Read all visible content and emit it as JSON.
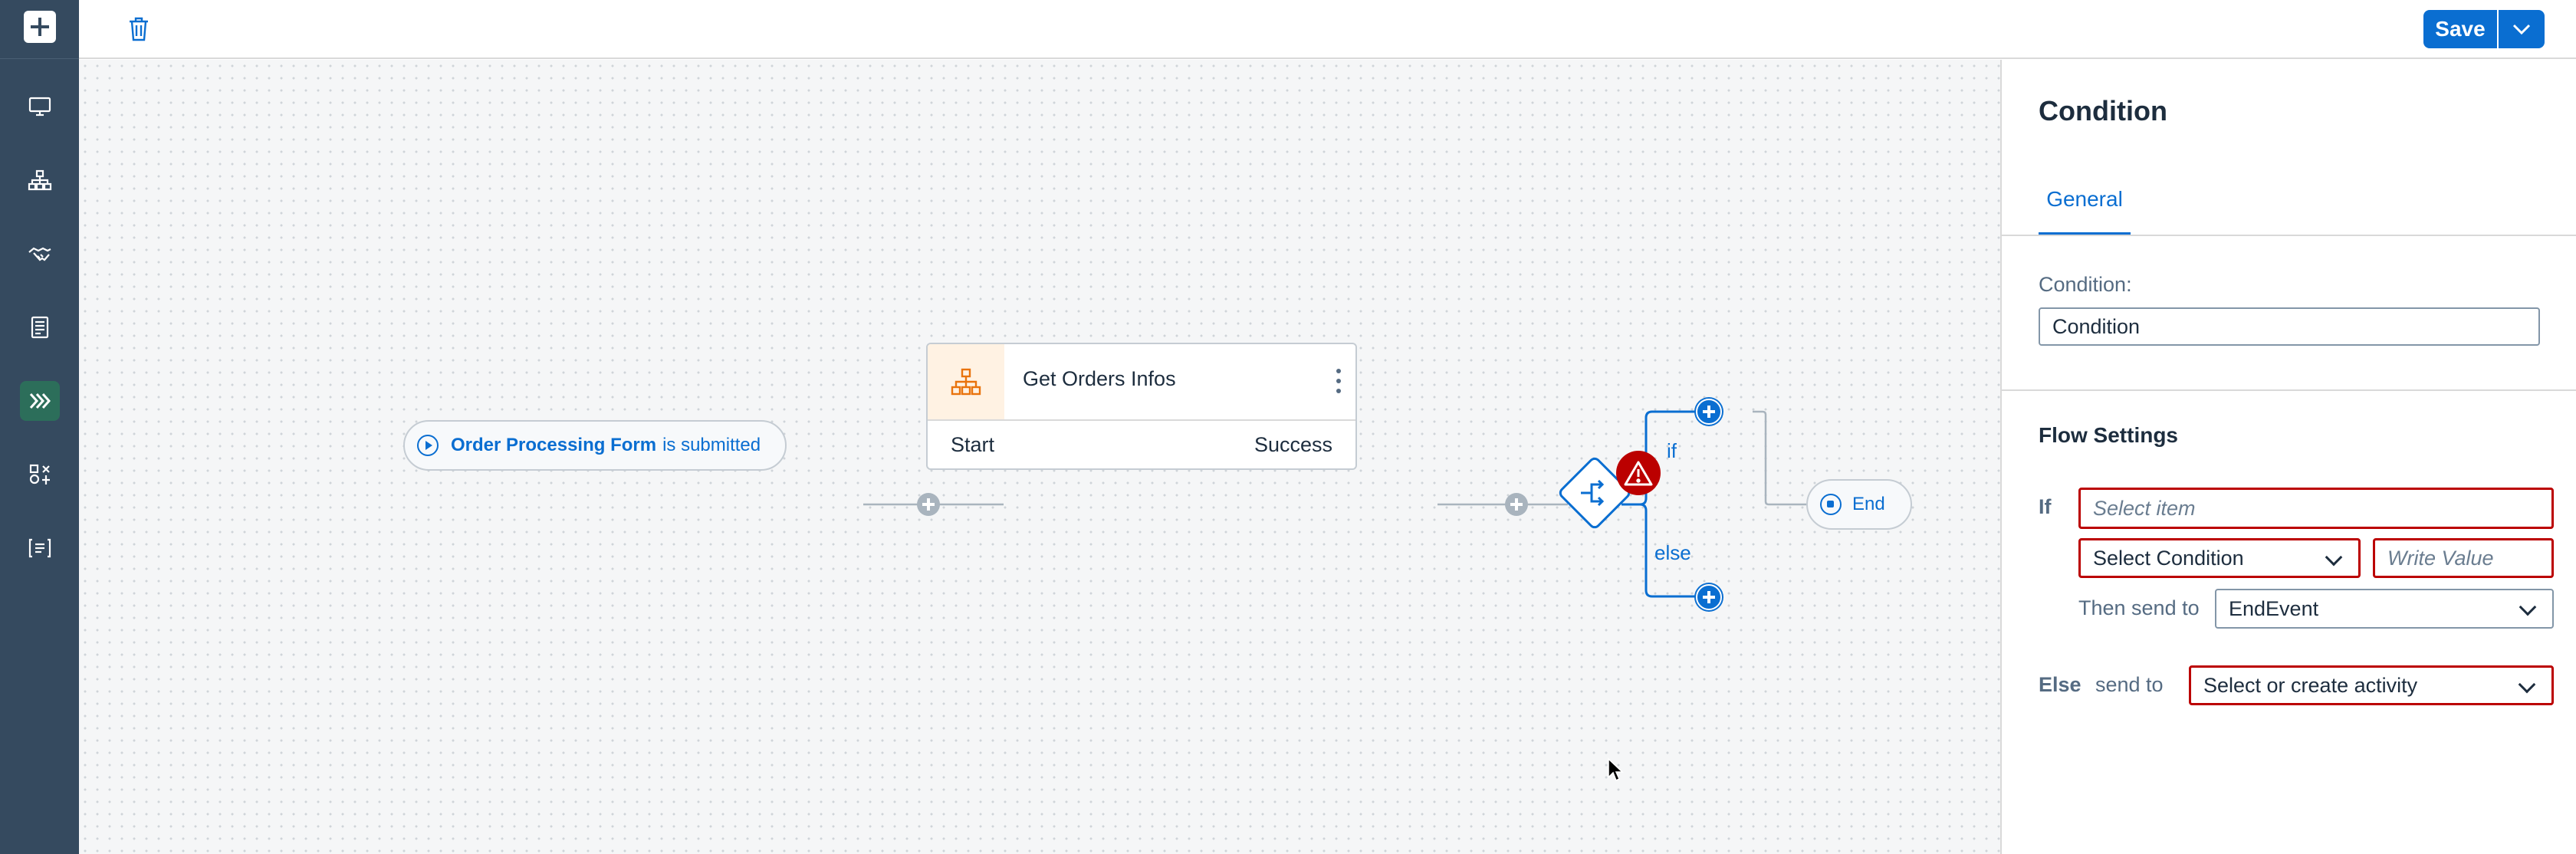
{
  "rail": {
    "items": [
      {
        "icon": "add-icon"
      },
      {
        "icon": "monitor-icon"
      },
      {
        "icon": "hierarchy-icon"
      },
      {
        "icon": "handshake-icon"
      },
      {
        "icon": "document-icon"
      },
      {
        "icon": "process-icon",
        "active": true
      },
      {
        "icon": "settings-icon"
      },
      {
        "icon": "form-icon"
      }
    ]
  },
  "toolbar": {
    "delete_icon": "trash-icon",
    "save_label": "Save",
    "save_menu_icon": "chevron-down-icon"
  },
  "canvas": {
    "trigger": {
      "name": "Order Processing Form",
      "suffix": "is submitted"
    },
    "activity": {
      "title": "Get Orders Infos",
      "start_label": "Start",
      "success_label": "Success"
    },
    "condition": {
      "if_label": "if",
      "else_label": "else"
    },
    "end_label": "End"
  },
  "panel": {
    "title": "Condition",
    "tabs": [
      {
        "label": "General",
        "selected": true
      }
    ],
    "condition_label": "Condition:",
    "condition_value": "Condition",
    "flow_settings_title": "Flow Settings",
    "if_label": "If",
    "select_item_placeholder": "Select item",
    "select_condition_value": "Select Condition",
    "write_value_placeholder": "Write Value",
    "then_label": "Then send to",
    "then_value": "EndEvent",
    "else_label": "Else",
    "else_send_label": "send to",
    "else_value": "Select or create activity"
  },
  "colors": {
    "accent": "#0a6ed1",
    "rail": "#354a5f",
    "error": "#bb0000",
    "active_rail": "#2c6e5a"
  }
}
